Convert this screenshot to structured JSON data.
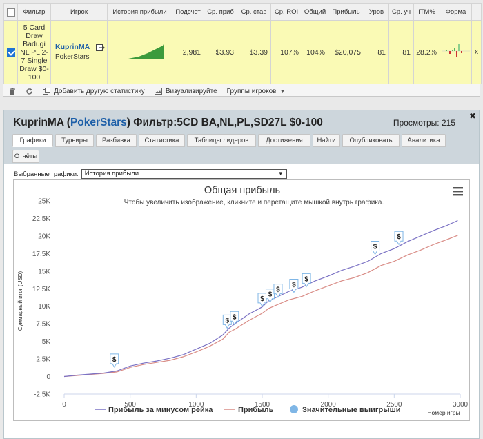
{
  "stats": {
    "headers": [
      "Фильтр",
      "Игрок",
      "История прибыли",
      "Подсчет",
      "Ср. приб",
      "Ср. став",
      "Ср. ROI",
      "Общий",
      "Прибыль",
      "Уров",
      "Ср. уч",
      "ITM%",
      "Форма"
    ],
    "row": {
      "filter": "5 Card Draw Badugi NL PL 2-7 Single Draw $0-100",
      "player": "KuprinMA",
      "site": "PokerStars",
      "count": "2,981",
      "avg_profit": "$3.93",
      "avg_stake": "$3.39",
      "avg_roi": "107%",
      "total_roi": "104%",
      "profit": "$20,075",
      "level": "81",
      "avg_entrants": "81",
      "itm": "28.2%",
      "close": "x"
    },
    "toolbar": {
      "add_stat": "Добавить другую статистику",
      "visualize": "Визуализируйте",
      "player_groups": "Группы игроков"
    }
  },
  "panel": {
    "title_player": "KuprinMA",
    "title_open": " (",
    "title_site": "PokerStars",
    "title_rest": ") Фильтр:5CD BA,NL,PL,SD27L $0-100",
    "views": "Просмотры: 215",
    "close": "✖",
    "tabs": [
      "Графики",
      "Турниры",
      "Разбивка",
      "Статистика",
      "Таблицы лидеров",
      "Достижения",
      "Найти",
      "Опубликовать",
      "Аналитика",
      "Отчёты"
    ],
    "graph_label": "Выбранные графики:",
    "graph_selected": "История прибыли"
  },
  "chart_data": {
    "type": "line",
    "title": "Общая прибыль",
    "subtitle": "Чтобы увеличить изображение, кликните и перетащите мышкой внутрь графика.",
    "xlabel": "Номер игры",
    "ylabel": "Суммарный итог (USD)",
    "xlim": [
      0,
      3000
    ],
    "ylim": [
      -2500,
      25000
    ],
    "x_ticks": [
      "0",
      "500",
      "1000",
      "1500",
      "2000",
      "2500",
      "3000"
    ],
    "y_ticks": [
      "-2.5K",
      "0",
      "2.5K",
      "5K",
      "7.5K",
      "10K",
      "12.5K",
      "15K",
      "17.5K",
      "20K",
      "22.5K",
      "25K"
    ],
    "series": [
      {
        "name": "Прибыль за минусом рейка",
        "color": "#7b72c4",
        "x": [
          0,
          100,
          200,
          300,
          400,
          500,
          600,
          700,
          800,
          900,
          1000,
          1100,
          1200,
          1250,
          1300,
          1400,
          1500,
          1550,
          1600,
          1700,
          1800,
          1900,
          2000,
          2100,
          2200,
          2300,
          2400,
          2500,
          2600,
          2700,
          2800,
          2900,
          2981
        ],
        "values": [
          0,
          200,
          350,
          500,
          800,
          1500,
          1900,
          2200,
          2600,
          3100,
          3900,
          4700,
          5900,
          6900,
          7600,
          8900,
          9900,
          10800,
          11200,
          12100,
          12700,
          13600,
          14300,
          15100,
          15700,
          16400,
          17500,
          18200,
          19200,
          20000,
          20800,
          21500,
          22200
        ]
      },
      {
        "name": "Прибыль",
        "color": "#d98c86",
        "x": [
          0,
          100,
          200,
          300,
          400,
          500,
          600,
          700,
          800,
          900,
          1000,
          1100,
          1200,
          1250,
          1300,
          1400,
          1500,
          1550,
          1600,
          1700,
          1800,
          1900,
          2000,
          2100,
          2200,
          2300,
          2400,
          2500,
          2600,
          2700,
          2800,
          2900,
          2981
        ],
        "values": [
          0,
          150,
          300,
          450,
          650,
          1300,
          1700,
          2000,
          2300,
          2800,
          3500,
          4300,
          5300,
          6300,
          6800,
          8000,
          9000,
          9700,
          10100,
          10900,
          11400,
          12200,
          12900,
          13600,
          14100,
          14800,
          15800,
          16400,
          17300,
          18000,
          18800,
          19500,
          20100
        ]
      }
    ],
    "big_wins": {
      "name": "Значительные выигрыши",
      "color": "#7fb6e6",
      "label": "$",
      "points": [
        {
          "x": 380,
          "y": 750
        },
        {
          "x": 1235,
          "y": 6300
        },
        {
          "x": 1290,
          "y": 6800
        },
        {
          "x": 1500,
          "y": 9400
        },
        {
          "x": 1560,
          "y": 10000
        },
        {
          "x": 1620,
          "y": 10700
        },
        {
          "x": 1740,
          "y": 11400
        },
        {
          "x": 1835,
          "y": 12200
        },
        {
          "x": 2355,
          "y": 16800
        },
        {
          "x": 2535,
          "y": 18200
        }
      ]
    },
    "legend_position": "bottom",
    "grid": false
  }
}
